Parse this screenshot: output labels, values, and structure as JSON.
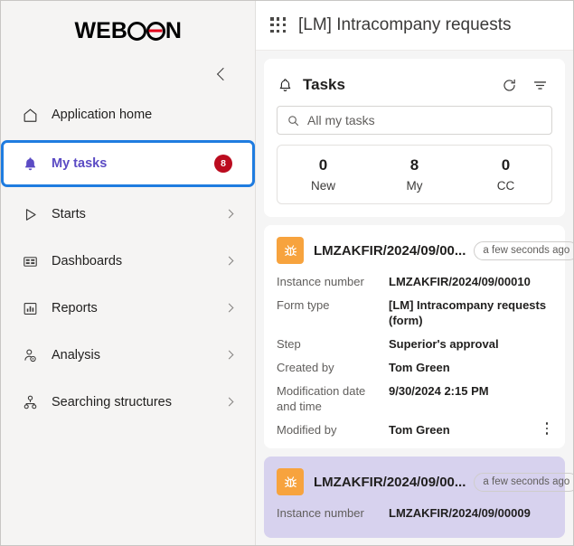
{
  "sidebar": {
    "logo": {
      "part1": "WEB",
      "part2": "C",
      "part3": "N",
      "brand_red": "#e2001a"
    },
    "collapse_tooltip": "Collapse",
    "items": [
      {
        "label": "Application home",
        "icon": "home-icon",
        "has_caret": false,
        "badge": null,
        "selected": false
      },
      {
        "label": "My tasks",
        "icon": "bell-icon",
        "has_caret": false,
        "badge": "8",
        "selected": true
      },
      {
        "label": "Starts",
        "icon": "play-icon",
        "has_caret": true,
        "badge": null,
        "selected": false
      },
      {
        "label": "Dashboards",
        "icon": "dashboard-icon",
        "has_caret": true,
        "badge": null,
        "selected": false
      },
      {
        "label": "Reports",
        "icon": "chart-icon",
        "has_caret": true,
        "badge": null,
        "selected": false
      },
      {
        "label": "Analysis",
        "icon": "person-info-icon",
        "has_caret": true,
        "badge": null,
        "selected": false
      },
      {
        "label": "Searching structures",
        "icon": "org-tree-icon",
        "has_caret": true,
        "badge": null,
        "selected": false
      }
    ]
  },
  "header": {
    "waffle_icon": "app-launcher-icon",
    "title": "[LM] Intracompany requests"
  },
  "tasks_panel": {
    "bell_icon": "bell-icon",
    "title": "Tasks",
    "refresh_icon": "refresh-icon",
    "filter_icon": "filter-icon",
    "search": {
      "icon": "search-icon",
      "placeholder": "All my tasks",
      "value": ""
    },
    "counters": [
      {
        "num": "0",
        "caption": "New"
      },
      {
        "num": "8",
        "caption": "My"
      },
      {
        "num": "0",
        "caption": "CC"
      }
    ]
  },
  "tasks": [
    {
      "icon": "bug-icon",
      "icon_color": "#f7a33e",
      "name": "LMZAKFIR/2024/09/00...",
      "time_ago": "a few seconds ago",
      "highlight": false,
      "fields": [
        {
          "label": "Instance number",
          "value": "LMZAKFIR/2024/09/00010"
        },
        {
          "label": "Form type",
          "value": "[LM] Intracompany requests (form)"
        },
        {
          "label": "Step",
          "value": "Superior's approval"
        },
        {
          "label": "Created by",
          "value": "Tom Green"
        },
        {
          "label": "Modification date and time",
          "value": "9/30/2024 2:15 PM"
        },
        {
          "label": "Modified by",
          "value": "Tom Green"
        }
      ],
      "kebab_icon": "more-options-icon"
    },
    {
      "icon": "bug-icon",
      "icon_color": "#f7a33e",
      "name": "LMZAKFIR/2024/09/00...",
      "time_ago": "a few seconds ago",
      "highlight": true,
      "fields": [
        {
          "label": "Instance number",
          "value": "LMZAKFIR/2024/09/00009"
        }
      ],
      "kebab_icon": "more-options-icon"
    }
  ],
  "colors": {
    "accent_purple": "#5b4bc4",
    "focus_blue": "#1f7ce0",
    "badge_red": "#bb0c1f",
    "icon_orange": "#f7a33e",
    "highlight_lavender": "#d7d2ee"
  }
}
